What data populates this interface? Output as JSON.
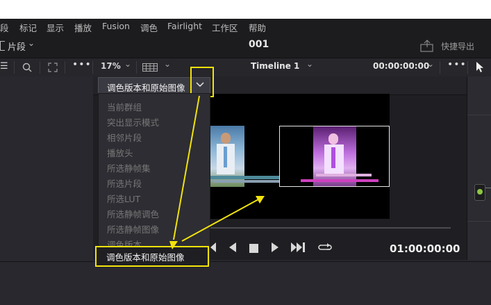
{
  "menubar": {
    "items": [
      "段",
      "标记",
      "显示",
      "播放",
      "Fusion",
      "调色",
      "Fairlight",
      "工作区",
      "帮助"
    ]
  },
  "titlebar": {
    "bin_label": "片段",
    "project_name": "001",
    "export_label": "快捷导出"
  },
  "toolbar": {
    "zoom": "17%",
    "timeline_name": "Timeline 1",
    "timecode": "00:00:00:00"
  },
  "wipe_dropdown": {
    "selected": "调色版本和原始图像",
    "options": [
      "当前群组",
      "突出显示模式",
      "相邻片段",
      "播放头",
      "所选静帧集",
      "所选片段",
      "所选LUT",
      "所选静帧调色",
      "所选静帧图像",
      "调色版本",
      "调色版本和原始图像"
    ]
  },
  "transport": {
    "timecode": "01:00:00:00"
  },
  "colors": {
    "highlight": "#f2e30b",
    "accent_node": "#8dc63f"
  },
  "icons": [
    "menu-icon",
    "search-icon",
    "fullscreen-icon",
    "more-icon",
    "chevron-down-icon",
    "grid-icon",
    "cursor-icon",
    "export-icon",
    "play-reverse-icon",
    "stop-icon",
    "play-icon",
    "skip-end-icon",
    "loop-icon"
  ]
}
